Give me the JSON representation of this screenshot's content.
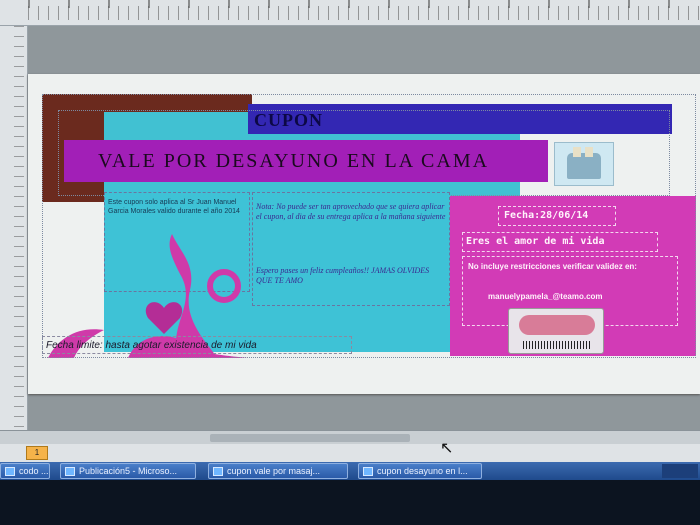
{
  "coupon": {
    "title": "CUPON",
    "subtitle": "VALE POR DESAYUNO EN LA CAMA",
    "valid_text": "Este cupon solo aplica al Sr Juan Manuel Garcia Morales valido durante el año 2014",
    "note_text": "Nota: No puede ser tan aprovechado que se quiera aplicar el cupon, al dia de su entrega aplica a la mañana siguiente",
    "closing_text": "Espero pases un feliz cumpleaños!! JAMAS OLVIDES QUE TE AMO",
    "date_text": "Fecha:28/06/14",
    "love_text": "Eres el amor de mi vida",
    "restrictions_text": "No incluye restricciones verificar validez en:",
    "email_text": "manuelypamela_@teamo.com",
    "deadline_text": "Fecha limite: hasta agotar existencia de mi vida"
  },
  "pagebar": {
    "page_number": "1"
  },
  "taskbar": {
    "items": [
      {
        "label": "codo ..."
      },
      {
        "label": "Publicación5 - Microso..."
      },
      {
        "label": "cupon vale por masaj..."
      },
      {
        "label": "cupon desayuno en l..."
      }
    ]
  },
  "colors": {
    "title_bar": "#3327b3",
    "subtitle_bar": "#a21fb7",
    "cyan": "#3ec2d6",
    "pink": "#d23bb6",
    "brown": "#6b2a1e"
  }
}
